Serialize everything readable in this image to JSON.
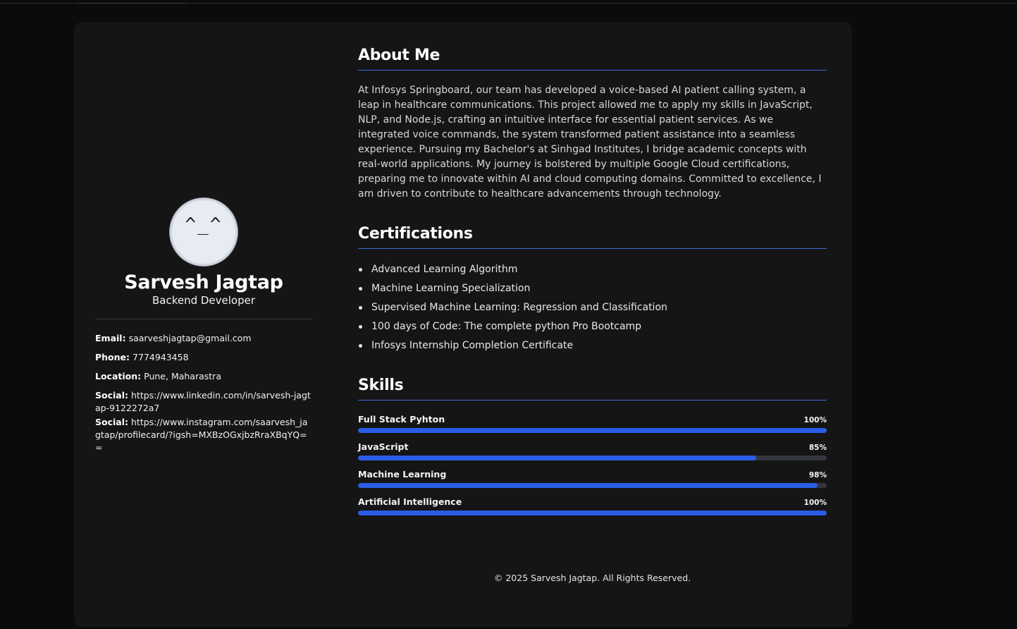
{
  "profile": {
    "avatar_text": "^_^",
    "name": "Sarvesh Jagtap",
    "role": "Backend Developer",
    "contacts": [
      {
        "label": "Email:",
        "value": "saarveshjagtap@gmail.com"
      },
      {
        "label": "Phone:",
        "value": "7774943458"
      },
      {
        "label": "Location:",
        "value": "Pune, Maharastra"
      },
      {
        "label": "Social:",
        "value": "https://www.linkedin.com/in/sarvesh-jagtap-9122272a7"
      },
      {
        "label": "Social:",
        "value": "https://www.instagram.com/saarvesh_jagtap/profilecard/?igsh=MXBzOGxjbzRraXBqYQ=="
      }
    ]
  },
  "about": {
    "heading": "About Me",
    "text": "At Infosys Springboard, our team has developed a voice-based AI patient calling system, a leap in healthcare communications. This project allowed me to apply my skills in JavaScript, NLP, and Node.js, crafting an intuitive interface for essential patient services. As we integrated voice commands, the system transformed patient assistance into a seamless experience. Pursuing my Bachelor's at Sinhgad Institutes, I bridge academic concepts with real-world applications. My journey is bolstered by multiple Google Cloud certifications, preparing me to innovate within AI and cloud computing domains. Committed to excellence, I am driven to contribute to healthcare advancements through technology."
  },
  "certifications": {
    "heading": "Certifications",
    "items": [
      "Advanced Learning Algorithm",
      "Machine Learning Specialization",
      "Supervised Machine Learning: Regression and Classification",
      "100 days of Code: The complete python Pro Bootcamp",
      "Infosys Internship Completion Certificate"
    ]
  },
  "skills": {
    "heading": "Skills",
    "items": [
      {
        "name": "Full Stack Pyhton",
        "percent_label": "100%",
        "level": 1.0
      },
      {
        "name": "JavaScript",
        "percent_label": "85%",
        "level": 0.85
      },
      {
        "name": "Machine Learning",
        "percent_label": "98%",
        "level": 0.98
      },
      {
        "name": "Artificial Intelligence",
        "percent_label": "100%",
        "level": 1.0
      }
    ]
  },
  "footer": {
    "text": "© 2025 Sarvesh Jagtap. All Rights Reserved."
  },
  "colors": {
    "accent": "#2a5ce6",
    "card": "#151516",
    "background": "#0b0b0c"
  }
}
